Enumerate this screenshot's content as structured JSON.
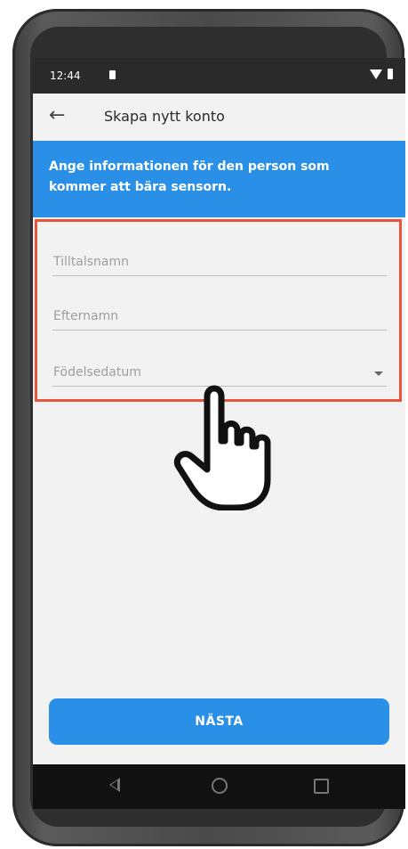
{
  "statusbar": {
    "time": "12:44"
  },
  "appbar": {
    "title": "Skapa nytt konto"
  },
  "banner": {
    "text": "Ange informationen för den person som kommer att bära sensorn."
  },
  "form": {
    "first_name": {
      "placeholder": "Tilltalsnamn",
      "value": ""
    },
    "last_name": {
      "placeholder": "Efternamn",
      "value": ""
    },
    "birthdate": {
      "placeholder": "Födelsedatum",
      "value": ""
    }
  },
  "actions": {
    "next_label": "NÄSTA"
  },
  "colors": {
    "accent": "#2a8fe6",
    "highlight": "#e8553a"
  },
  "icons": [
    "back-arrow-icon",
    "dropdown-arrow-icon",
    "wifi-icon",
    "battery-icon",
    "nav-back-icon",
    "nav-home-icon",
    "nav-recent-icon",
    "pointing-hand-icon"
  ]
}
